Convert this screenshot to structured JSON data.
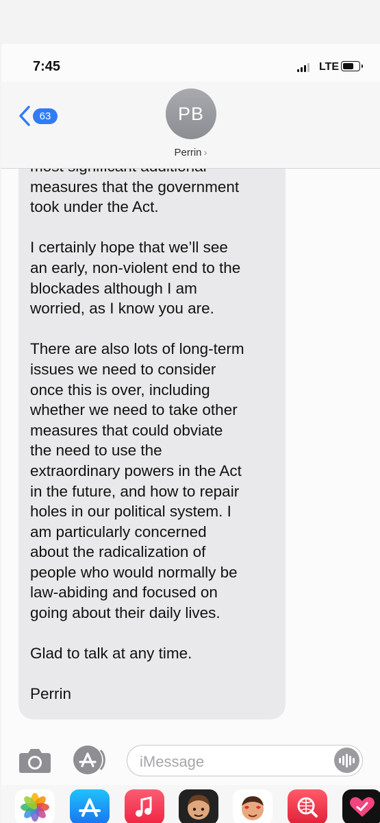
{
  "status_bar": {
    "time": "7:45",
    "network": "LTE"
  },
  "header": {
    "back_count": "63",
    "avatar_initials": "PB",
    "contact_name": "Perrin",
    "contact_chevron": "›"
  },
  "message": {
    "lines": [
      "most significant additional",
      "measures that the government",
      "took under the Act.",
      "",
      "I certainly hope that we’ll see",
      "an early, non-violent end to the",
      "blockades although I am",
      "worried, as I know you are.",
      "",
      "There are also lots of long-term",
      "issues we need to consider",
      "once this is over, including",
      "whether we need to take other",
      "measures that could obviate",
      "the need to use the",
      "extraordinary powers in the Act",
      "in the future, and how to repair",
      "holes in our political system. I",
      "am particularly concerned",
      "about the radicalization of",
      "people who would normally be",
      "law-abiding and focused on",
      "going about their daily lives.",
      "",
      "Glad to talk at any time.",
      "",
      "Perrin"
    ]
  },
  "input": {
    "placeholder": "iMessage"
  },
  "icons": {
    "camera": "camera-icon",
    "apps": "app-store-icon",
    "audio": "audio-waveform-icon",
    "drawer": [
      "photos-app",
      "app-store-app",
      "music-app",
      "memoji-app",
      "animoji-app",
      "web-search-app",
      "digital-touch-app"
    ]
  },
  "colors": {
    "accent": "#2f7cf6",
    "bubble": "#e9e9eb"
  }
}
